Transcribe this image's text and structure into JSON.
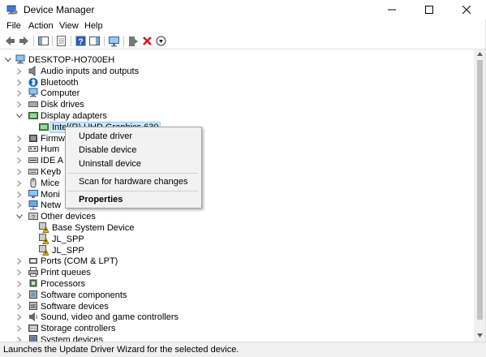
{
  "window": {
    "title": "Device Manager"
  },
  "menu": [
    "File",
    "Action",
    "View",
    "Help"
  ],
  "tree": {
    "root": "DESKTOP-HO700EH",
    "items": [
      {
        "label": "Audio inputs and outputs",
        "icon": "speaker-icon"
      },
      {
        "label": "Bluetooth",
        "icon": "bluetooth-icon"
      },
      {
        "label": "Computer",
        "icon": "computer-icon"
      },
      {
        "label": "Disk drives",
        "icon": "disk-drive-icon"
      },
      {
        "label": "Display adapters",
        "icon": "display-adapter-icon"
      },
      {
        "label": "Intel(R) UHD Graphics 630",
        "icon": "display-adapter-icon"
      },
      {
        "label": "Firmw",
        "icon": "firmware-icon"
      },
      {
        "label": "Hum",
        "icon": "hid-icon"
      },
      {
        "label": "IDE A",
        "icon": "ide-icon"
      },
      {
        "label": "Keyb",
        "icon": "keyboard-icon"
      },
      {
        "label": "Mice",
        "icon": "mouse-icon"
      },
      {
        "label": "Moni",
        "icon": "monitor-icon"
      },
      {
        "label": "Netw",
        "icon": "network-icon"
      },
      {
        "label": "Other devices",
        "icon": "unknown-device-icon"
      },
      {
        "label": "Base System Device",
        "icon": "warning-device-icon"
      },
      {
        "label": "JL_SPP",
        "icon": "warning-device-icon"
      },
      {
        "label": "JL_SPP",
        "icon": "warning-device-icon"
      },
      {
        "label": "Ports (COM & LPT)",
        "icon": "port-icon"
      },
      {
        "label": "Print queues",
        "icon": "printer-icon"
      },
      {
        "label": "Processors",
        "icon": "processor-icon"
      },
      {
        "label": "Software components",
        "icon": "software-component-icon"
      },
      {
        "label": "Software devices",
        "icon": "software-device-icon"
      },
      {
        "label": "Sound, video and game controllers",
        "icon": "sound-icon"
      },
      {
        "label": "Storage controllers",
        "icon": "storage-icon"
      },
      {
        "label": "System devices",
        "icon": "system-device-icon"
      }
    ]
  },
  "context_menu": {
    "update": "Update driver",
    "disable": "Disable device",
    "uninstall": "Uninstall device",
    "scan": "Scan for hardware changes",
    "properties": "Properties"
  },
  "status": "Launches the Update Driver Wizard for the selected device.",
  "colors": {
    "selection": "#cce8ff",
    "menu_bg": "#f2f2f2",
    "status_bg": "#f0f0f0"
  }
}
